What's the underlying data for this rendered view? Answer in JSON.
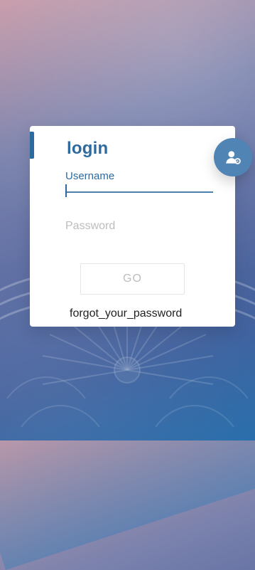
{
  "login": {
    "title": "login",
    "username_label": "Username",
    "username_value": "",
    "password_placeholder": "Password",
    "go_button_label": "GO",
    "forgot_password_link": "forgot_your_password"
  },
  "icons": {
    "avatar_fab": "user-settings-icon"
  },
  "colors": {
    "accent": "#2d6aa0",
    "fab": "#4f84b4"
  }
}
